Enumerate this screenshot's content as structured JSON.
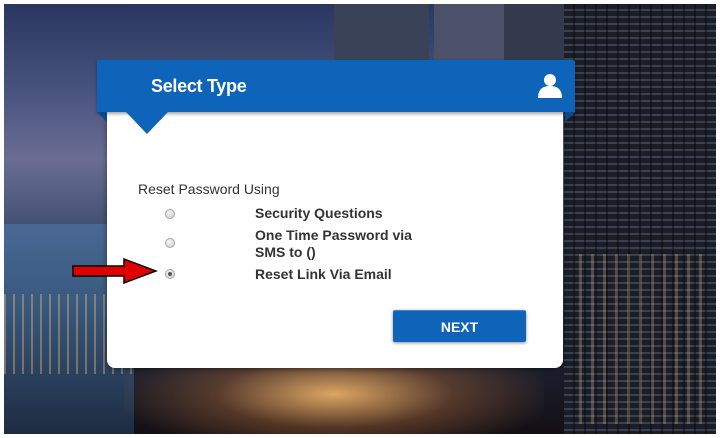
{
  "dialog": {
    "title": "Select Type",
    "user_icon": "user-icon"
  },
  "form": {
    "prompt": "Reset Password Using",
    "options": [
      {
        "label": "Security Questions",
        "selected": false
      },
      {
        "label": "One Time Password via SMS to ()",
        "selected": false
      },
      {
        "label": "Reset Link Via Email",
        "selected": true
      }
    ],
    "next_label": "NEXT"
  },
  "annotation": {
    "arrow_icon": "red-arrow-icon",
    "arrow_color": "#e00000"
  },
  "colors": {
    "accent": "#0e64b9"
  }
}
